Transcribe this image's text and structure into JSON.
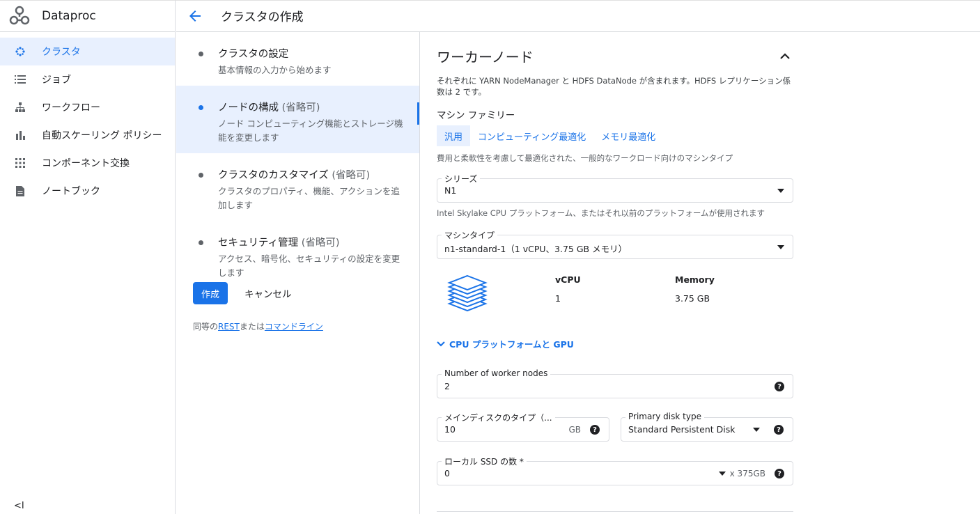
{
  "app": {
    "name": "Dataproc"
  },
  "sidebar": {
    "items": [
      {
        "label": "クラスタ",
        "icon": "cluster-icon",
        "active": true
      },
      {
        "label": "ジョブ",
        "icon": "list-icon"
      },
      {
        "label": "ワークフロー",
        "icon": "workflow-icon"
      },
      {
        "label": "自動スケーリング ポリシー",
        "icon": "bar-chart-icon"
      },
      {
        "label": "コンポーネント交換",
        "icon": "grid-icon"
      },
      {
        "label": "ノートブック",
        "icon": "document-icon"
      }
    ],
    "collapse_label": "<I"
  },
  "header": {
    "title": "クラスタの作成"
  },
  "steps": [
    {
      "title": "クラスタの設定",
      "optional": "",
      "desc": "基本情報の入力から始めます"
    },
    {
      "title": "ノードの構成",
      "optional": "(省略可)",
      "desc": "ノード コンピューティング機能とストレージ機能を変更します"
    },
    {
      "title": "クラスタのカスタマイズ",
      "optional": "(省略可)",
      "desc": "クラスタのプロパティ、機能、アクションを追加します"
    },
    {
      "title": "セキュリティ管理",
      "optional": "(省略可)",
      "desc": "アクセス、暗号化、セキュリティの設定を変更します"
    }
  ],
  "actions": {
    "create": "作成",
    "cancel": "キャンセル"
  },
  "equiv": {
    "prefix": "同等の",
    "rest": "REST",
    "middle": "または",
    "cli": "コマンドライン"
  },
  "section": {
    "title": "ワーカーノード",
    "desc": "それぞれに YARN NodeManager と HDFS DataNode が含まれます。HDFS レプリケーション係数は 2 です。"
  },
  "machine_family": {
    "label": "マシン ファミリー",
    "tabs": [
      "汎用",
      "コンピューティング最適化",
      "メモリ最適化"
    ],
    "desc": "費用と柔軟性を考慮して最適化された、一般的なワークロード向けのマシンタイプ"
  },
  "series": {
    "label": "シリーズ",
    "value": "N1",
    "hint": "Intel Skylake CPU プラットフォーム、またはそれ以前のプラットフォームが使用されます"
  },
  "machine_type": {
    "label": "マシンタイプ",
    "value": "n1-standard-1（1 vCPU、3.75 GB メモリ）"
  },
  "specs": {
    "vcpu_label": "vCPU",
    "vcpu": "1",
    "memory_label": "Memory",
    "memory": "3.75 GB"
  },
  "cpu_platform": {
    "label": "CPU プラットフォームと GPU"
  },
  "worker_nodes": {
    "label": "Number of worker nodes",
    "value": "2"
  },
  "primary_disk_size": {
    "label": "メインディスクのタイプ（...",
    "value": "10",
    "unit": "GB"
  },
  "primary_disk_type": {
    "label": "Primary disk type",
    "value": "Standard Persistent Disk"
  },
  "local_ssd": {
    "label": "ローカル SSD の数 *",
    "value": "0",
    "unit": "x 375GB"
  },
  "colors": {
    "accent": "#1a73e8",
    "active_bg": "#e8f0fe"
  }
}
